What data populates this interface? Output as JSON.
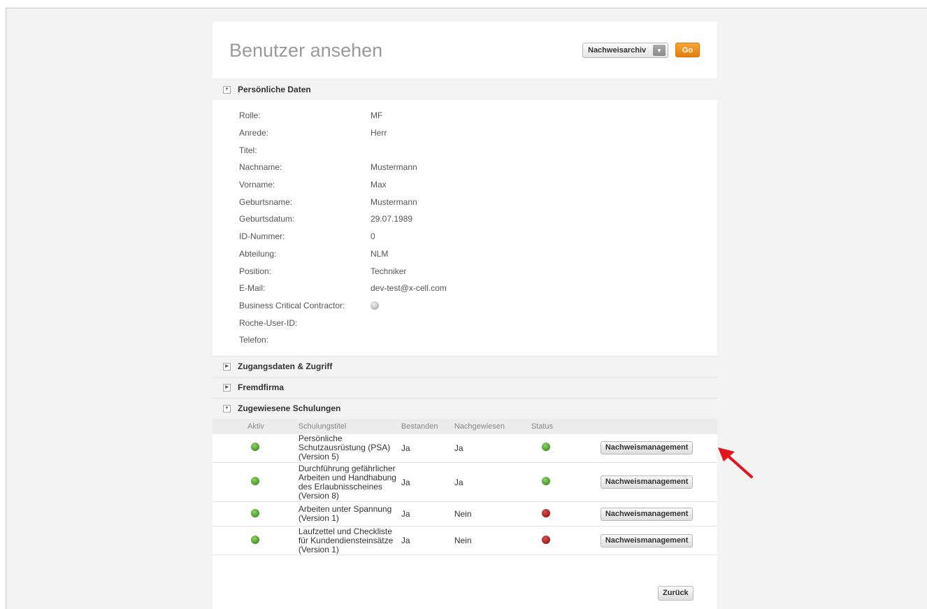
{
  "header": {
    "title": "Benutzer ansehen",
    "select_value": "Nachweisarchiv",
    "go_label": "Go"
  },
  "sections": {
    "personal": "Persönliche Daten",
    "access": "Zugangsdaten & Zugriff",
    "external": "Fremdfirma",
    "trainings": "Zugewiesene Schulungen"
  },
  "personal": [
    {
      "label": "Rolle:",
      "value": "MF"
    },
    {
      "label": "Anrede:",
      "value": "Herr"
    },
    {
      "label": "Titel:",
      "value": ""
    },
    {
      "label": "Nachname:",
      "value": "Mustermann"
    },
    {
      "label": "Vorname:",
      "value": "Max"
    },
    {
      "label": "Geburtsname:",
      "value": "Mustermann"
    },
    {
      "label": "Geburtsdatum:",
      "value": "29.07.1989"
    },
    {
      "label": "ID-Nummer:",
      "value": "0"
    },
    {
      "label": "Abteilung:",
      "value": "NLM"
    },
    {
      "label": "Position:",
      "value": "Techniker"
    },
    {
      "label": "E-Mail:",
      "value": "dev-test@x-cell.com"
    },
    {
      "label": "Business Critical Contractor:",
      "value": ""
    },
    {
      "label": "Roche-User-ID:",
      "value": ""
    },
    {
      "label": "Telefon:",
      "value": ""
    }
  ],
  "table": {
    "columns": [
      "Aktiv",
      "Schulungstitel",
      "Bestanden",
      "Nachgewiesen",
      "Status"
    ],
    "rows": [
      {
        "title": "Persönliche Schutzausrüstung (PSA) (Version 5)",
        "passed": "Ja",
        "proven": "Ja",
        "status": "green",
        "action": "Nachweismanagement"
      },
      {
        "title": "Durchführung gefährlicher Arbeiten und Handhabung des Erlaubnisscheines (Version 8)",
        "passed": "Ja",
        "proven": "Ja",
        "status": "green",
        "action": "Nachweismanagement"
      },
      {
        "title": "Arbeiten unter Spannung (Version 1)",
        "passed": "Ja",
        "proven": "Nein",
        "status": "red",
        "action": "Nachweismanagement"
      },
      {
        "title": "Laufzettel und Checkliste für Kundendiensteinsätze (Version 1)",
        "passed": "Ja",
        "proven": "Nein",
        "status": "red",
        "action": "Nachweismanagement"
      }
    ]
  },
  "footer": {
    "back_label": "Zurück"
  },
  "colors": {
    "accent": "#f39a2a",
    "status_green": "#4d9a2a",
    "status_red": "#a51c1c",
    "annotation_arrow": "#e3141b"
  },
  "icons": {
    "collapse": "triangle-down-icon",
    "expand": "triangle-right-icon",
    "dropdown": "chevron-down-icon",
    "annotation": "red-arrow-icon"
  }
}
